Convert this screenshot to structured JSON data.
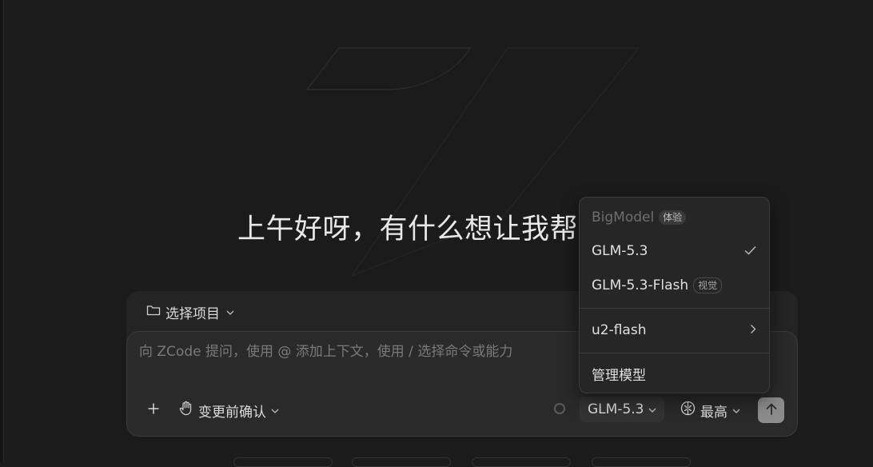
{
  "greeting": "上午好呀，有什么想让我帮",
  "project_selector": {
    "label": "选择项目",
    "icon": "folder-icon"
  },
  "prompt": {
    "placeholder": "向 ZCode 提问，使用 @ 添加上下文，使用 / 选择命令或能力",
    "value": ""
  },
  "toolbar": {
    "add_icon": "plus-icon",
    "confirm_label": "变更前确认",
    "confirm_icon": "hand-icon",
    "model_label": "GLM-5.3",
    "effort_label": "最高",
    "effort_icon": "brain-icon",
    "send_icon": "arrow-up-icon"
  },
  "model_menu": {
    "header": "BigModel",
    "header_badge": "体验",
    "items": [
      {
        "label": "GLM-5.3",
        "selected": true
      },
      {
        "label": "GLM-5.3-Flash",
        "badge": "视觉"
      },
      {
        "label": "u2-flash",
        "has_submenu": true
      },
      {
        "label": "管理模型"
      }
    ]
  },
  "colors": {
    "background": "#1b1b1b",
    "panel": "#262626",
    "send_button": "#8c8c8c"
  }
}
